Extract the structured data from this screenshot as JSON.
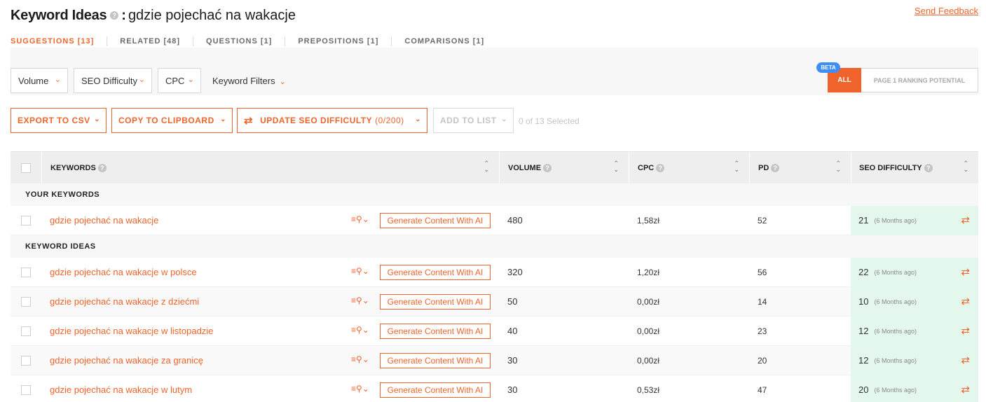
{
  "header": {
    "title": "Keyword Ideas",
    "help": "?",
    "colon": ":",
    "query": "gdzie pojechać na wakacje",
    "feedback": "Send Feedback"
  },
  "tabs": [
    {
      "label": "SUGGESTIONS [13]",
      "active": true
    },
    {
      "label": "RELATED [48]",
      "active": false
    },
    {
      "label": "QUESTIONS [1]",
      "active": false
    },
    {
      "label": "PREPOSITIONS [1]",
      "active": false
    },
    {
      "label": "COMPARISONS [1]",
      "active": false
    }
  ],
  "filters": {
    "volume": "Volume",
    "seo_difficulty": "SEO Difficulty",
    "cpc": "CPC",
    "keyword_filters": "Keyword Filters",
    "beta": "BETA",
    "all": "ALL",
    "page1": "PAGE 1 RANKING POTENTIAL"
  },
  "actions": {
    "export": "EXPORT TO CSV",
    "copy": "COPY TO CLIPBOARD",
    "update": "UPDATE SEO DIFFICULTY",
    "update_count": "(0/200)",
    "add_list": "ADD TO LIST",
    "selected": "0 of 13 Selected"
  },
  "table": {
    "columns": {
      "keywords": "KEYWORDS",
      "volume": "VOLUME",
      "cpc": "CPC",
      "pd": "PD",
      "seo": "SEO DIFFICULTY"
    },
    "sections": {
      "yours": "YOUR KEYWORDS",
      "ideas": "KEYWORD IDEAS"
    },
    "generate_label": "Generate Content With AI",
    "your_rows": [
      {
        "keyword": "gdzie pojechać na wakacje",
        "volume": "480",
        "cpc": "1,58zł",
        "pd": "52",
        "sd": "21",
        "ago": "(6 Months ago)"
      }
    ],
    "idea_rows": [
      {
        "keyword": "gdzie pojechać na wakacje w polsce",
        "volume": "320",
        "cpc": "1,20zł",
        "pd": "56",
        "sd": "22",
        "ago": "(6 Months ago)"
      },
      {
        "keyword": "gdzie pojechać na wakacje z dziećmi",
        "volume": "50",
        "cpc": "0,00zł",
        "pd": "14",
        "sd": "10",
        "ago": "(6 Months ago)"
      },
      {
        "keyword": "gdzie pojechać na wakacje w listopadzie",
        "volume": "40",
        "cpc": "0,00zł",
        "pd": "23",
        "sd": "12",
        "ago": "(6 Months ago)"
      },
      {
        "keyword": "gdzie pojechać na wakacje za granicę",
        "volume": "30",
        "cpc": "0,00zł",
        "pd": "20",
        "sd": "12",
        "ago": "(6 Months ago)"
      },
      {
        "keyword": "gdzie pojechać na wakacje w lutym",
        "volume": "30",
        "cpc": "0,53zł",
        "pd": "47",
        "sd": "20",
        "ago": "(6 Months ago)"
      }
    ]
  },
  "colors": {
    "accent": "#f0642c",
    "beta": "#3f8ef5",
    "seo_good_bg": "#e4f7ec"
  }
}
